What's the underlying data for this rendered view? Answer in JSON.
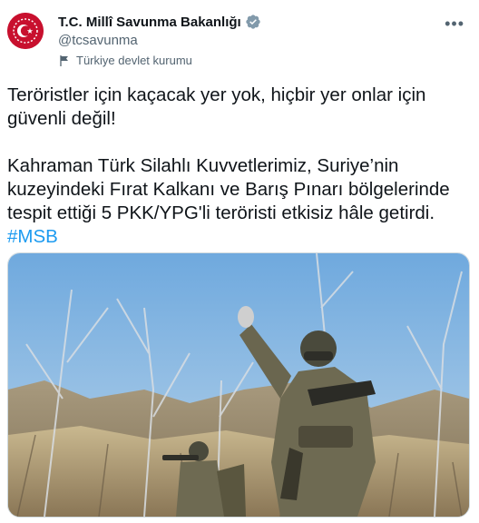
{
  "account": {
    "display_name": "T.C. Millî Savunma Bakanlığı",
    "handle": "@tcsavunma",
    "label": "Türkiye devlet kurumu",
    "verified": true,
    "avatar_color": "#c8102e"
  },
  "menu": {
    "more_icon": "more-icon"
  },
  "tweet": {
    "paragraph1": "Teröristler için kaçacak yer yok, hiçbir yer onlar için güvenli değil!",
    "paragraph2": "Kahraman Türk Silahlı Kuvvetlerimiz, Suriye’nin kuzeyindeki Fırat Kalkanı ve Barış Pınarı bölgelerinde tespit ettiği 5 PKK/YPG'li teröristi etkisiz hâle getirdi.",
    "hashtag": "#MSB"
  },
  "colors": {
    "link": "#1d9bf0",
    "verified": "#829aab",
    "muted": "#536471"
  }
}
